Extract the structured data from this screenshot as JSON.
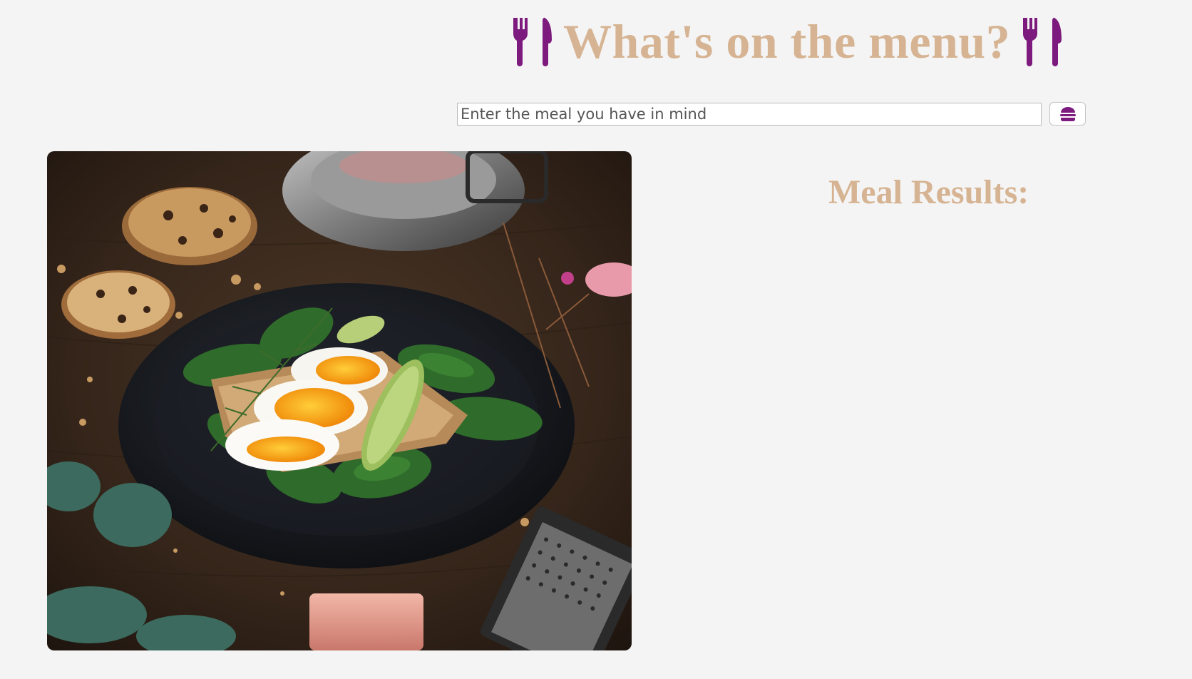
{
  "header": {
    "title": "What's on the menu?",
    "left_icon": "utensils-icon",
    "right_icon": "utensils-icon"
  },
  "search": {
    "placeholder": "Enter the meal you have in mind",
    "value": "",
    "button_icon": "hamburger-icon"
  },
  "hero_image": {
    "alt": "Plate of sliced boiled eggs on toast with avocado and spinach"
  },
  "results": {
    "heading": "Meal Results:",
    "items": []
  },
  "colors": {
    "background": "#f4f4f4",
    "title": "#d6b493",
    "accent": "#7d1a7d"
  }
}
